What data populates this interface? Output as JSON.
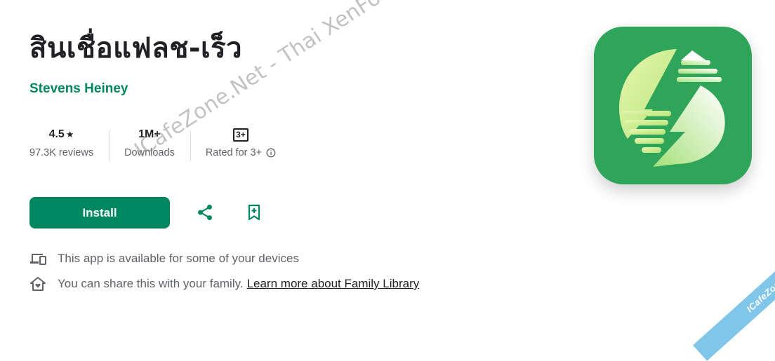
{
  "app": {
    "title": "สินเชื่อแฟลช-เร็ว",
    "developer": "Stevens Heiney"
  },
  "stats": {
    "rating": {
      "value": "4.5",
      "star": "★",
      "label": "97.3K reviews"
    },
    "downloads": {
      "value": "1M+",
      "label": "Downloads"
    },
    "content_rating": {
      "badge": "3+",
      "label": "Rated for 3+"
    }
  },
  "actions": {
    "install_label": "Install",
    "share_icon": "share-icon",
    "wishlist_icon": "bookmark-add-icon"
  },
  "availability": {
    "devices_text": "This app is available for some of your devices",
    "family_text": "You can share this with your family.",
    "family_link": "Learn more about Family Library"
  },
  "watermark": {
    "text": "ICafeZone.Net - Thai XenForo Community",
    "corner_badge": "ICafeZone"
  },
  "colors": {
    "accent": "#01875f",
    "icon_bg": "#2fa55a",
    "ribbon": "#7fc6e8"
  }
}
